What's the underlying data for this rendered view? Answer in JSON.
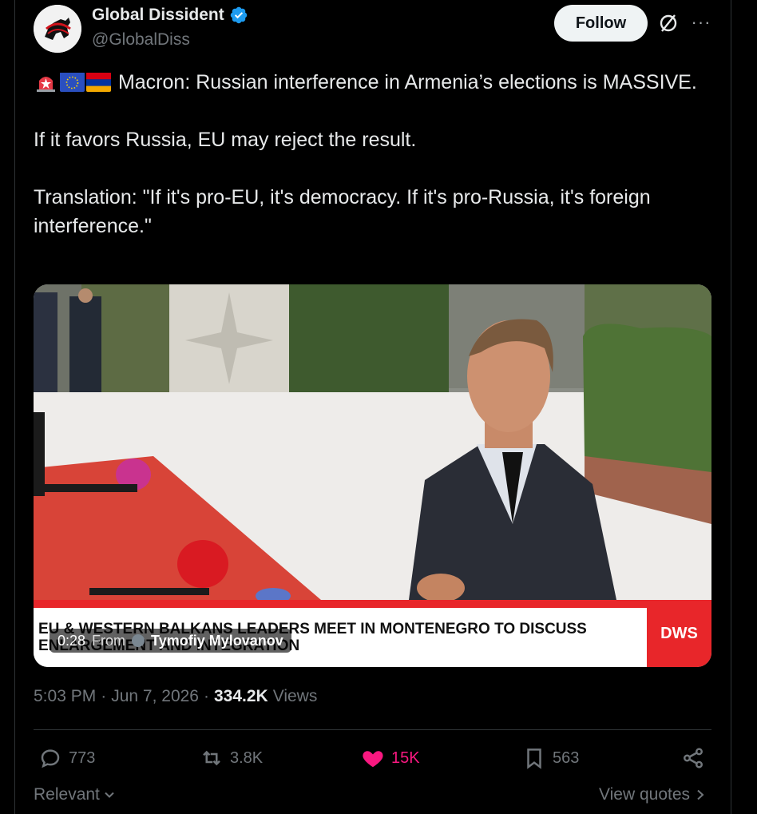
{
  "author": {
    "display_name": "Global Dissident",
    "handle": "@GlobalDiss"
  },
  "follow_label": "Follow",
  "tweet": {
    "line1": "Macron: Russian interference in Armenia’s elections is MASSIVE.",
    "line2": "If it favors Russia, EU may reject the result.",
    "line3": "Translation: \"If it's pro-EU, it's democracy. If it's pro-Russia, it's foreign interference.\"",
    "emoji_flags": [
      "rotating-light-icon",
      "eu-flag-icon",
      "armenia-flag-icon"
    ]
  },
  "video": {
    "ticker_text": "EU & WESTERN BALKANS LEADERS MEET IN MONTENEGRO TO DISCUSS ENLARGEMENT AND INTEGRATION",
    "channel_badge": "DWS",
    "duration": "0:28",
    "from_label": "From",
    "from_name": "Tymofiy Mylovanov",
    "mic_label": "inter"
  },
  "meta": {
    "time": "5:03 PM",
    "separator": "·",
    "date": "Jun 7, 2026",
    "views_count": "334.2K",
    "views_label": "Views"
  },
  "actions": {
    "replies": "773",
    "reposts": "3.8K",
    "likes": "15K",
    "bookmarks": "563"
  },
  "footer": {
    "sort_label": "Relevant",
    "view_quotes": "View quotes"
  },
  "colors": {
    "background": "#000000",
    "text": "#e7e9ea",
    "muted": "#71767b",
    "verified": "#1d9bf0",
    "like": "#f91880",
    "ticker_red": "#e8262a"
  }
}
